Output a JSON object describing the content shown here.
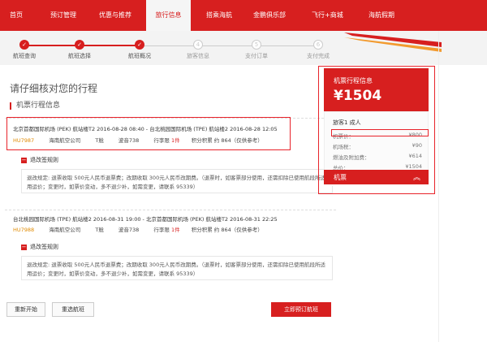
{
  "nav": {
    "items": [
      "首页",
      "预订管理",
      "优惠与推荐",
      "旅行信息",
      "搭乘海航",
      "金鹏俱乐部",
      "飞行+商城",
      "海航假期"
    ],
    "active_index": 3
  },
  "progress": {
    "steps": [
      {
        "label": "航班查询",
        "mark": "✓"
      },
      {
        "label": "航班选择",
        "mark": "✓"
      },
      {
        "label": "航班概况",
        "mark": "✓"
      },
      {
        "label": "旅客信息",
        "mark": "4"
      },
      {
        "label": "支付订单",
        "mark": "5"
      },
      {
        "label": "支付完成",
        "mark": "6"
      }
    ],
    "current_step": 3
  },
  "main": {
    "page_title": "请仔细核对您的行程",
    "section_title": "机票行程信息",
    "segments": [
      {
        "route": "北京首都国际机场 (PEK) 航站楼T2 2016-08-28 08:40 - 台北桃园国际机场 (TPE) 航站楼2 2016-08-28 12:05",
        "flight_no": "HU7987",
        "airline": "海南航空公司",
        "cabin": "T舱",
        "aircraft": "波音738",
        "baggage_prefix": "行李限",
        "baggage_count": "1件",
        "points": "积分积累 约 864（仅供参考）",
        "rule_title": "退改签规则",
        "rule_text": "退改规定: 退票收取 500元人民币退票费；改期收取 300元人民币改期费。（退票时，如客票部分使用，还需扣除已使用航段所适用运价；变更时，如票价变动，多不退少补，如需变更，请联系 95339）"
      },
      {
        "route": "台北桃园国际机场 (TPE) 航站楼2 2016-08-31 19:00 - 北京首都国际机场 (PEK) 航站楼T2 2016-08-31 22:25",
        "flight_no": "HU7988",
        "airline": "海南航空公司",
        "cabin": "T舱",
        "aircraft": "波音738",
        "baggage_prefix": "行李限",
        "baggage_count": "1件",
        "points": "积分积累 约 864（仅供参考）",
        "rule_title": "退改签规则",
        "rule_text": "退改规定: 退票收取 500元人民币退票费；改期收取 300元人民币改期费。（退票时，如客票部分使用，还需扣除已使用航段所适用运价；变更时，如票价变动，多不退少补，如需变更，请联系 95339）"
      }
    ]
  },
  "sidebar": {
    "title": "机票行程信息",
    "total": "¥1504",
    "passenger": "旅客1 成人",
    "rows": [
      {
        "label": "机票价：",
        "value": "¥800"
      },
      {
        "label": "机场税：",
        "value": "¥90"
      },
      {
        "label": "燃油及附加费：",
        "value": "¥614"
      },
      {
        "label": "总价：",
        "value": "¥1504"
      }
    ],
    "footer_label": "机票",
    "footer_chevron": "︽"
  },
  "buttons": {
    "restart": "重新开始",
    "reselect": "重选航班",
    "book": "立即预订航班"
  },
  "colors": {
    "brand": "#d71f1f",
    "flight_no": "#e08a00"
  }
}
